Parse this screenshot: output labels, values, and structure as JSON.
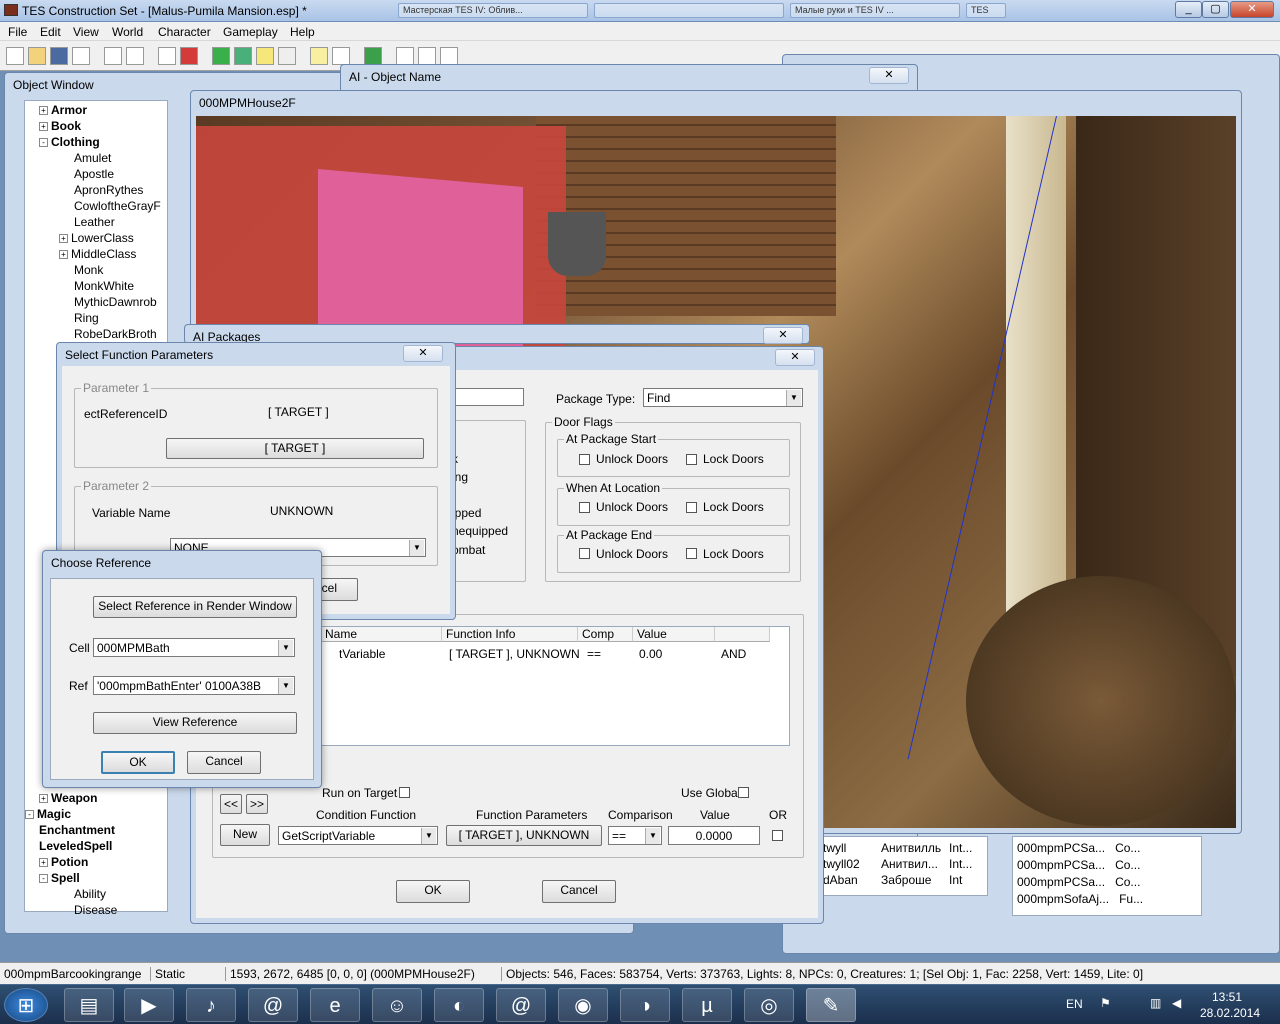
{
  "app": {
    "title": "TES Construction Set - [Malus-Pumila Mansion.esp] *",
    "min": "_",
    "max": "▢",
    "close": "✕"
  },
  "taskbar_tabs": [
    "Мастерская ТЕS IV: Облив...",
    "",
    "Малые руки и TES IV ...",
    "TES"
  ],
  "menu": [
    "File",
    "Edit",
    "View",
    "World",
    "Character",
    "Gameplay",
    "Help"
  ],
  "object_window": {
    "title": "Object Window",
    "tree": [
      {
        "label": "Armor",
        "level": 0,
        "bold": true,
        "exp": "+"
      },
      {
        "label": "Book",
        "level": 0,
        "bold": true,
        "exp": "+"
      },
      {
        "label": "Clothing",
        "level": 0,
        "bold": true,
        "exp": "-"
      },
      {
        "label": "Amulet",
        "level": 1
      },
      {
        "label": "Apostle",
        "level": 1
      },
      {
        "label": "ApronRythes",
        "level": 1
      },
      {
        "label": "CowloftheGrayF",
        "level": 1
      },
      {
        "label": "Leather",
        "level": 1
      },
      {
        "label": "LowerClass",
        "level": 1,
        "exp": "+"
      },
      {
        "label": "MiddleClass",
        "level": 1,
        "exp": "+"
      },
      {
        "label": "Monk",
        "level": 1
      },
      {
        "label": "MonkWhite",
        "level": 1
      },
      {
        "label": "MythicDawnrob",
        "level": 1
      },
      {
        "label": "Ring",
        "level": 1
      },
      {
        "label": "RobeDarkBroth",
        "level": 1
      }
    ],
    "tree_bottom": [
      {
        "label": "Weapon",
        "level": 0,
        "bold": true,
        "exp": "+"
      },
      {
        "label": "Magic",
        "level": -1,
        "bold": true,
        "exp": "-"
      },
      {
        "label": "Enchantment",
        "level": 0,
        "bold": true
      },
      {
        "label": "LeveledSpell",
        "level": 0,
        "bold": true
      },
      {
        "label": "Potion",
        "level": 0,
        "bold": true,
        "exp": "+"
      },
      {
        "label": "Spell",
        "level": 0,
        "bold": true,
        "exp": "-"
      },
      {
        "label": "Ability",
        "level": 1
      },
      {
        "label": "Disease",
        "level": 1
      }
    ]
  },
  "ai_object_window": {
    "title": "AI - Object Name",
    "close": "✕"
  },
  "render_window": {
    "title": "000MPMHouse2F"
  },
  "ai_packages": {
    "title": "AI Packages",
    "close": "✕",
    "package_type_label": "Package Type:",
    "package_type": "Find",
    "door_flags": "Door Flags",
    "at_start": "At Package Start",
    "at_location": "When At Location",
    "at_end": "At Package End",
    "unlock": "Unlock Doors",
    "lock": "Lock Doors",
    "partial_flags": [
      "k",
      "ing",
      "ipped",
      "nequipped",
      "ombat"
    ],
    "table_headers": [
      "Name",
      "Function Info",
      "Comp",
      "Value",
      ""
    ],
    "row": [
      "tVariable",
      "[ TARGET ], UNKNOWN",
      "==",
      "0.00",
      "AND"
    ],
    "run_on_target": "Run on Target",
    "use_global": "Use Global",
    "cond_func_label": "Condition Function",
    "func_params_label": "Function Parameters",
    "comparison_label": "Comparison",
    "value_label": "Value",
    "or_label": "OR",
    "new": "New",
    "cond_func": "GetScriptVariable",
    "func_params": "[ TARGET ], UNKNOWN",
    "comparison": "==",
    "value": "0.0000",
    "prev": "<<",
    "next": ">>",
    "ok": "OK",
    "cancel": "Cancel"
  },
  "select_params": {
    "title": "Select Function Parameters",
    "close": "✕",
    "p1": "Parameter 1",
    "p1_name": "ectReferenceID",
    "p1_val": "[ TARGET ]",
    "p1_btn": "[ TARGET ]",
    "p2": "Parameter 2",
    "p2_name": "Variable Name",
    "p2_val": "UNKNOWN",
    "p2_combo": "NONE",
    "cancel_partial": "cel"
  },
  "choose_ref": {
    "title": "Choose Reference",
    "select_btn": "Select Reference in Render Window",
    "cell_label": "Cell",
    "cell": "000MPMBath",
    "ref_label": "Ref",
    "ref": "'000mpmBathEnter' 0100A38B",
    "view_btn": "View Reference",
    "ok": "OK",
    "cancel": "Cancel"
  },
  "right_list": {
    "rows": [
      [
        "twyll",
        "Анитвилль",
        "Int..."
      ],
      [
        "twyll02",
        "Анитвил...",
        "Int..."
      ],
      [
        "dAban",
        "Заброше",
        "Int"
      ]
    ]
  },
  "far_list": {
    "rows": [
      [
        "000mpmPCSa...",
        "Co..."
      ],
      [
        "000mpmPCSa...",
        "Co..."
      ],
      [
        "000mpmPCSa...",
        "Co..."
      ],
      [
        "000mpmSofaAj...",
        "Fu..."
      ]
    ]
  },
  "status": [
    "000mpmBarcookingrange",
    "Static",
    "1593, 2672, 6485 [0, 0, 0] (000MPMHouse2F)",
    "Objects: 546, Faces: 583754, Verts: 373763, Lights: 8, NPCs: 0, Creatures: 1; [Sel Obj: 1, Fac: 2258, Vert: 1459, Lite: 0]"
  ],
  "tray": {
    "lang": "EN",
    "time": "13:51",
    "date": "28.02.2014"
  },
  "colors": {
    "accent": "#1c5ea8",
    "pink": "#e0609a",
    "wood": "#7a5a32"
  }
}
